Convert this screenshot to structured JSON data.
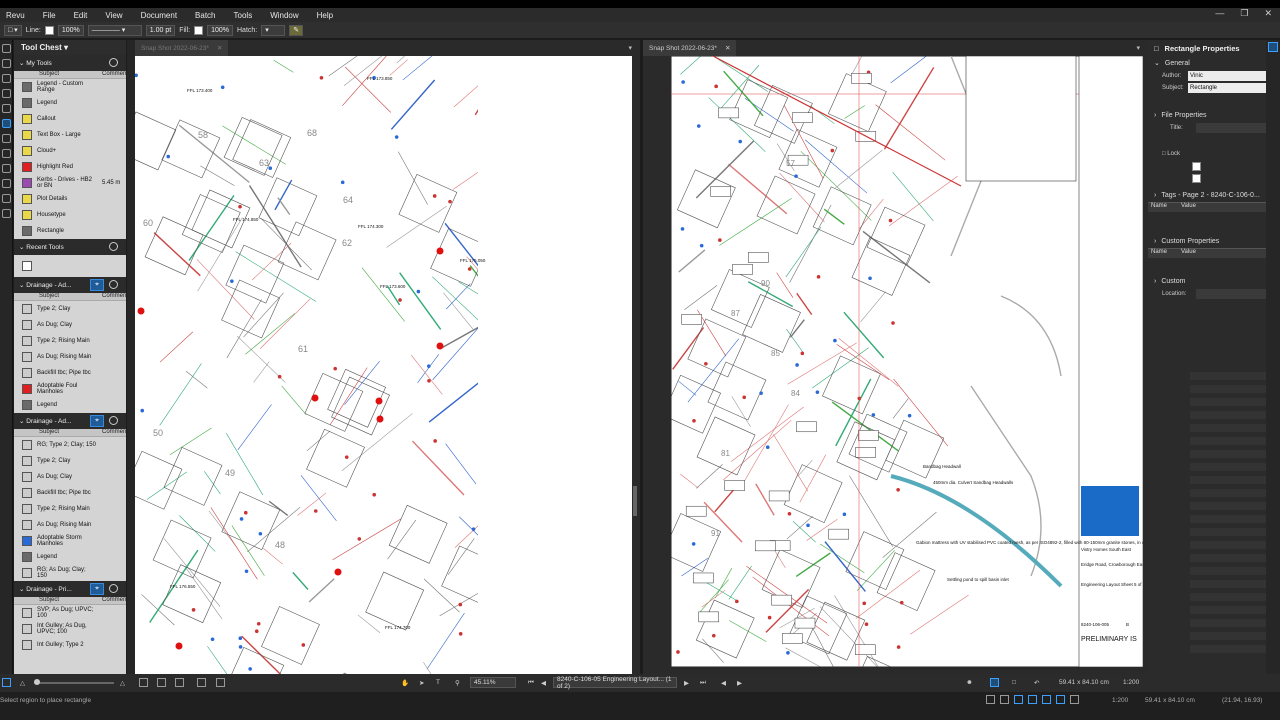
{
  "menu": [
    "Revu",
    "File",
    "Edit",
    "View",
    "Document",
    "Batch",
    "Tools",
    "Window",
    "Help"
  ],
  "properties_bar": {
    "line_label": "Line:",
    "opacity1": "100%",
    "width": "1.00 pt",
    "fill_label": "Fill:",
    "opacity2": "100%",
    "hatch_label": "Hatch:"
  },
  "tool_chest": {
    "title": "Tool Chest",
    "col_subject": "Subject",
    "col_comment": "Commen",
    "sections": [
      {
        "name": "My Tools",
        "tools": [
          {
            "label": "Legend - Custom Range",
            "value": "",
            "icon_color": "#6a6a6a"
          },
          {
            "label": "Legend",
            "value": "",
            "icon_color": "#6a6a6a"
          },
          {
            "label": "Callout",
            "value": "",
            "icon_color": "#e8d84a"
          },
          {
            "label": "Text Box - Large",
            "value": "",
            "icon_color": "#e8d84a"
          },
          {
            "label": "Cloud+",
            "value": "",
            "icon_color": "#e8d84a"
          },
          {
            "label": "Highlight Red",
            "value": "",
            "icon_color": "#e02020"
          },
          {
            "label": "Kerbs - Drives - HB2 or BN",
            "value": "5.45 m",
            "icon_color": "#9a4ab0"
          },
          {
            "label": "Plot Details",
            "value": "",
            "icon_color": "#e8d84a"
          },
          {
            "label": "Housetype",
            "value": "",
            "icon_color": "#e8d84a"
          },
          {
            "label": "Rectangle",
            "value": "",
            "icon_color": "#6a6a6a"
          }
        ]
      },
      {
        "name": "Recent Tools",
        "tools": [
          {
            "label": "",
            "value": "",
            "icon_color": "#ffffff"
          }
        ]
      },
      {
        "name": "Drainage - Ad...",
        "tools": [
          {
            "label": "Type 2; Clay",
            "value": "",
            "icon_color": "#cccccc"
          },
          {
            "label": "As Dug; Clay",
            "value": "",
            "icon_color": "#cccccc"
          },
          {
            "label": "Type 2; Rising Main",
            "value": "",
            "icon_color": "#cccccc"
          },
          {
            "label": "As Dug; Rising Main",
            "value": "",
            "icon_color": "#cccccc"
          },
          {
            "label": "Backfill tbc; Pipe tbc",
            "value": "",
            "icon_color": "#cccccc"
          },
          {
            "label": "Adoptable Foul Manholes",
            "value": "",
            "icon_color": "#e02020"
          },
          {
            "label": "Legend",
            "value": "",
            "icon_color": "#6a6a6a"
          }
        ]
      },
      {
        "name": "Drainage - Ad...",
        "tools": [
          {
            "label": "RG; Type 2; Clay; 150",
            "value": "",
            "icon_color": "#cccccc"
          },
          {
            "label": "Type 2; Clay",
            "value": "",
            "icon_color": "#cccccc"
          },
          {
            "label": "As Dug; Clay",
            "value": "",
            "icon_color": "#cccccc"
          },
          {
            "label": "Backfill tbc; Pipe tbc",
            "value": "",
            "icon_color": "#cccccc"
          },
          {
            "label": "Type 2; Rising Main",
            "value": "",
            "icon_color": "#cccccc"
          },
          {
            "label": "As Dug; Rising Main",
            "value": "",
            "icon_color": "#cccccc"
          },
          {
            "label": "Adoptable Storm Manholes",
            "value": "",
            "icon_color": "#2a6ad8"
          },
          {
            "label": "Legend",
            "value": "",
            "icon_color": "#6a6a6a"
          },
          {
            "label": "RG; As Dug; Clay; 150",
            "value": "",
            "icon_color": "#cccccc"
          }
        ]
      },
      {
        "name": "Drainage - Pri...",
        "tools": [
          {
            "label": "SVP; As Dug; UPVC; 100",
            "value": "",
            "icon_color": "#cccccc"
          },
          {
            "label": "Int Gulley; As Dug, UPVC; 100",
            "value": "",
            "icon_color": "#cccccc"
          },
          {
            "label": "Int Gulley; Type 2",
            "value": "",
            "icon_color": "#cccccc"
          }
        ]
      }
    ]
  },
  "tabs": {
    "left": "Snap Shot 2022-06-23*",
    "right": "Snap Shot 2022-06-23*"
  },
  "drawing": {
    "fll_labels": [
      "FFL 173.400",
      "FFL 173.850",
      "FFL 174.300",
      "FFL 174.850",
      "FFL 176.550",
      "FFL 175.050",
      "FFL 173.600",
      "FFL 174.700"
    ],
    "plot_numbers": [
      "58",
      "68",
      "63",
      "64",
      "62",
      "61",
      "60",
      "50",
      "49",
      "48",
      "90",
      "87",
      "85",
      "84",
      "81",
      "91",
      "57"
    ],
    "notes": [
      "Bandbag Headwall",
      "450mm dia. Culvert Sandbag Headwalls",
      "Gabion mattress with UV stabilised PVC coated mesh, as per ISO4892-2, filled with 80-150mm granite stones, in order to disperse and reduce the flow rate",
      "Settling pond to spill basin inlet"
    ],
    "title_block": {
      "client": "Vistry Homes South East",
      "project": "Eridge Road, Crowborough East Sussex. TN6 2SJ",
      "drawing_title": "Engineering Layout Sheet 5 of 7",
      "drawing_no": "8240-106-005",
      "rev": "B",
      "status": "PRELIMINARY IS"
    }
  },
  "properties_panel": {
    "title": "Rectangle Properties",
    "general": "General",
    "author_label": "Author:",
    "author": "Vinic",
    "subject_label": "Subject:",
    "subject": "Rectangle",
    "file_properties": "File Properties",
    "title_label": "Title:",
    "lock_label": "Lock",
    "tags": "Tags - Page 2 - 8240-C-106-0...",
    "name_col": "Name",
    "value_col": "Value",
    "custom_props": "Custom Properties",
    "custom": "Custom",
    "location_label": "Location:"
  },
  "bottom": {
    "zoom": "45.11%",
    "page_select": "8240-C-106-05 Engineering Layout... (1 of 2)",
    "dimensions": "59.41 x 84.10 cm",
    "scale": "1:200"
  },
  "status": {
    "hint": "Select region to place rectangle",
    "scale": "1:200",
    "dimensions": "59.41 x 84.10 cm",
    "coords": "(21.94, 16.93)"
  }
}
